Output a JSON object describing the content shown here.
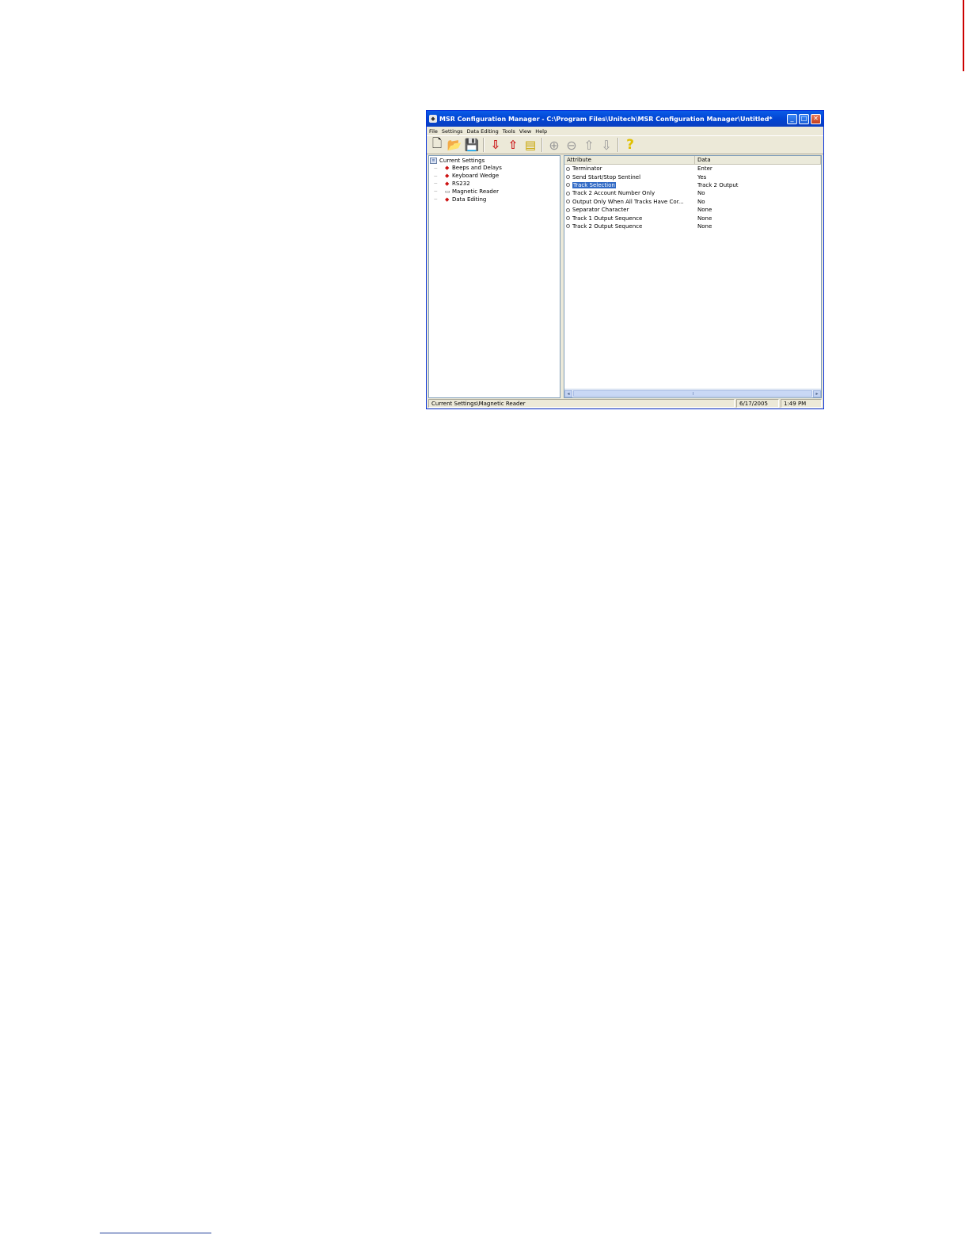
{
  "window": {
    "title": "MSR Configuration Manager - C:\\Program Files\\Unitech\\MSR Configuration Manager\\Untitled*",
    "controls": {
      "minimize": "_",
      "maximize": "□",
      "close": "✕"
    }
  },
  "menu": [
    "File",
    "Settings",
    "Data Editing",
    "Tools",
    "View",
    "Help"
  ],
  "toolbar": {
    "buttons": [
      {
        "name": "new-document",
        "glyph": "🗋"
      },
      {
        "name": "open-folder",
        "glyph": "📂"
      },
      {
        "name": "save",
        "glyph": "💾"
      },
      {
        "name": "download",
        "glyph": "⇩"
      },
      {
        "name": "upload",
        "glyph": "⇧"
      },
      {
        "name": "notes",
        "glyph": "▤"
      },
      {
        "name": "add",
        "glyph": "⊕"
      },
      {
        "name": "remove",
        "glyph": "⊖"
      },
      {
        "name": "move-up",
        "glyph": "⇧"
      },
      {
        "name": "move-down",
        "glyph": "⇩"
      },
      {
        "name": "help",
        "glyph": "?"
      }
    ]
  },
  "tree": {
    "root": "Current Settings",
    "items": [
      "Beeps and Delays",
      "Keyboard Wedge",
      "RS232",
      "Magnetic Reader",
      "Data Editing"
    ]
  },
  "list": {
    "headers": {
      "attribute": "Attribute",
      "data": "Data"
    },
    "rows": [
      {
        "attribute": "Terminator",
        "data": "Enter"
      },
      {
        "attribute": "Send Start/Stop Sentinel",
        "data": "Yes"
      },
      {
        "attribute": "Track Selection",
        "data": "Track 2 Output"
      },
      {
        "attribute": "Track 2 Account Number Only",
        "data": "No"
      },
      {
        "attribute": "Output Only When All Tracks Have Cor...",
        "data": "No"
      },
      {
        "attribute": "Separator Character",
        "data": "None"
      },
      {
        "attribute": "Track 1 Output Sequence",
        "data": "None"
      },
      {
        "attribute": "Track 2 Output Sequence",
        "data": "None"
      }
    ],
    "selected_index": 2
  },
  "status": {
    "path": "Current Settings\\Magnetic Reader",
    "date": "6/17/2005",
    "time": "1:49 PM"
  },
  "colors": {
    "titlebar": "#0245d3",
    "selection": "#316ac5",
    "tree_node": "#cc1111"
  }
}
